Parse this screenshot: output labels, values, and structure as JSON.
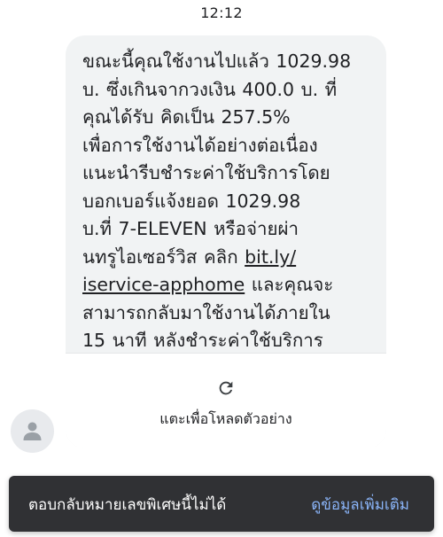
{
  "status_bar": {
    "time": "12:12"
  },
  "message": {
    "lines": [
      "ขณะนี้คุณใช้งานไปแล้ว 1029.98",
      "บ. ซึ่งเกินจากวงเงิน 400.0 บ. ที่",
      "คุณได้รับ คิดเป็น 257.5%",
      "เพื่อการใช้งานได้อย่างต่อเนื่อง",
      "แนะนำรีบชำระค่าใช้บริการโดย",
      "บอกเบอร์แจ้งยอด 1029.98",
      "บ.ที่ 7-ELEVEN หรือจ่ายผ่า",
      "นทรูไอเซอร์วิส คลิก "
    ],
    "link_part1": "bit.ly/",
    "link_part2": "iservice-apphome",
    "after_link": " และคุณจะ",
    "lines_end": [
      "สามารถกลับมาใช้งานได้ภายใน",
      "15 นาที หลังชำระค่าใช้บริการ"
    ]
  },
  "link_preview": {
    "icon": "reload-icon",
    "label": "แตะเพื่อโหลดตัวอย่าง"
  },
  "sender": {
    "icon": "person-icon"
  },
  "snackbar": {
    "message": "ตอบกลับหมายเลขพิเศษนี้ไม่ได้",
    "action": "ดูข้อมูลเพิ่มเติม"
  },
  "colors": {
    "bubble": "#f1f3f4",
    "snackbar": "#303134",
    "action": "#8ab4f8"
  }
}
